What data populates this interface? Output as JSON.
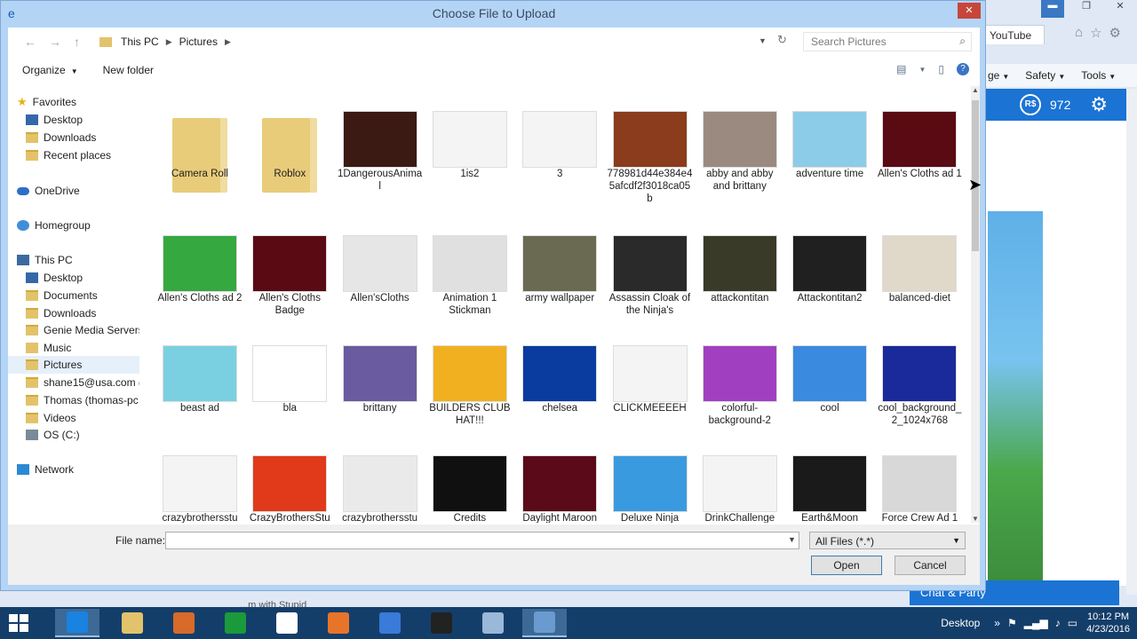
{
  "browser": {
    "tab_label": "YouTube",
    "command_bar": [
      "ge",
      "Safety",
      "Tools"
    ],
    "robux_symbol": "R$",
    "robux": "972",
    "chat": "Chat & Party",
    "status_text": "...m with Stupid"
  },
  "dialog": {
    "title": "Choose File to Upload",
    "address": [
      "This PC",
      "Pictures"
    ],
    "search_placeholder": "Search Pictures",
    "toolbar": {
      "organize": "Organize",
      "new_folder": "New folder"
    },
    "nav": [
      {
        "label": "Favorites",
        "icon": "star-icon"
      },
      {
        "label": "Desktop",
        "icon": "desktop-icon"
      },
      {
        "label": "Downloads",
        "icon": "folder-icon"
      },
      {
        "label": "Recent places",
        "icon": "folder-icon"
      },
      {
        "label": "OneDrive",
        "icon": "cloud-icon"
      },
      {
        "label": "Homegroup",
        "icon": "homegroup-icon"
      },
      {
        "label": "This PC",
        "icon": "computer-icon"
      },
      {
        "label": "Desktop",
        "icon": "desktop-icon"
      },
      {
        "label": "Documents",
        "icon": "folder-icon"
      },
      {
        "label": "Downloads",
        "icon": "folder-icon"
      },
      {
        "label": "Genie Media Servers",
        "icon": "folder-icon"
      },
      {
        "label": "Music",
        "icon": "music-folder-icon"
      },
      {
        "label": "Pictures",
        "icon": "folder-icon"
      },
      {
        "label": "shane15@usa.com (",
        "icon": "folder-icon"
      },
      {
        "label": "Thomas (thomas-pc",
        "icon": "folder-icon"
      },
      {
        "label": "Videos",
        "icon": "folder-icon"
      },
      {
        "label": "OS (C:)",
        "icon": "drive-icon"
      },
      {
        "label": "Network",
        "icon": "network-icon"
      }
    ],
    "files": [
      {
        "label": "Camera Roll",
        "color": "#e8cc7a"
      },
      {
        "label": "Roblox",
        "color": "#e8cc7a"
      },
      {
        "label": "1DangerousAnimal",
        "color": "#3a1a12"
      },
      {
        "label": "1is2",
        "color": "#f4f4f4"
      },
      {
        "label": "3",
        "color": "#f4f4f4"
      },
      {
        "label": "778981d44e384e45afcdf2f3018ca05b",
        "color": "#8a3c1c"
      },
      {
        "label": "abby and abby and brittany",
        "color": "#9a8a80"
      },
      {
        "label": "adventure time",
        "color": "#8ccce8"
      },
      {
        "label": "Allen's Cloths ad 1",
        "color": "#5a0a12"
      },
      {
        "label": "Allen's Cloths ad 2",
        "color": "#36a840"
      },
      {
        "label": "Allen's Cloths Badge",
        "color": "#5a0a12"
      },
      {
        "label": "Allen'sCloths",
        "color": "#e6e6e6"
      },
      {
        "label": "Animation 1 Stickman",
        "color": "#e0e0e0"
      },
      {
        "label": "army wallpaper",
        "color": "#6a6a52"
      },
      {
        "label": "Assassin Cloak of the Ninja's",
        "color": "#2a2a2a"
      },
      {
        "label": "attackontitan",
        "color": "#3a3a28"
      },
      {
        "label": "Attackontitan2",
        "color": "#202020"
      },
      {
        "label": "balanced-diet",
        "color": "#e0d8c8"
      },
      {
        "label": "beast ad",
        "color": "#7ad0e0"
      },
      {
        "label": "bla",
        "color": "#ffffff"
      },
      {
        "label": "brittany",
        "color": "#6a5aa0"
      },
      {
        "label": "BUILDERS CLUB HAT!!!",
        "color": "#f0b020"
      },
      {
        "label": "chelsea",
        "color": "#0a3ca0"
      },
      {
        "label": "CLICKMEEEEH",
        "color": "#f4f4f4"
      },
      {
        "label": "colorful-background-2",
        "color": "#a040c0"
      },
      {
        "label": "cool",
        "color": "#3a8ae0"
      },
      {
        "label": "cool_background_2_1024x768",
        "color": "#1a2a9a"
      },
      {
        "label": "crazybrothersstu",
        "color": "#f4f4f4"
      },
      {
        "label": "CrazyBrothersStu",
        "color": "#e03a1a"
      },
      {
        "label": "crazybrothersstu",
        "color": "#eaeaea"
      },
      {
        "label": "Credits",
        "color": "#101010"
      },
      {
        "label": "Daylight Maroon",
        "color": "#5a0a18"
      },
      {
        "label": "Deluxe Ninja",
        "color": "#3a9ae0"
      },
      {
        "label": "DrinkChallenge",
        "color": "#f4f4f4"
      },
      {
        "label": "Earth&Moon",
        "color": "#1a1a1a"
      },
      {
        "label": "Force Crew Ad 1",
        "color": "#d8d8d8"
      }
    ],
    "file_name_label": "File name:",
    "file_name_value": "",
    "filter": "All Files (*.*)",
    "open": "Open",
    "cancel": "Cancel"
  },
  "taskbar": {
    "desktop": "Desktop",
    "time": "10:12 PM",
    "date": "4/23/2016",
    "apps": [
      {
        "name": "internet-explorer",
        "color": "#1a82e0",
        "active": true
      },
      {
        "name": "file-explorer",
        "color": "#e2c36b",
        "active": false
      },
      {
        "name": "app-3",
        "color": "#d86a2a",
        "active": false
      },
      {
        "name": "store",
        "color": "#1a9a3a",
        "active": false
      },
      {
        "name": "amazon",
        "color": "#ffffff",
        "active": false
      },
      {
        "name": "app-6",
        "color": "#e8742a",
        "active": false
      },
      {
        "name": "app-7",
        "color": "#3a7ad8",
        "active": false
      },
      {
        "name": "app-8",
        "color": "#222222",
        "active": false
      },
      {
        "name": "app-9",
        "color": "#9ab8d8",
        "active": false
      },
      {
        "name": "paint",
        "color": "#6a9ad0",
        "active": true
      }
    ]
  }
}
